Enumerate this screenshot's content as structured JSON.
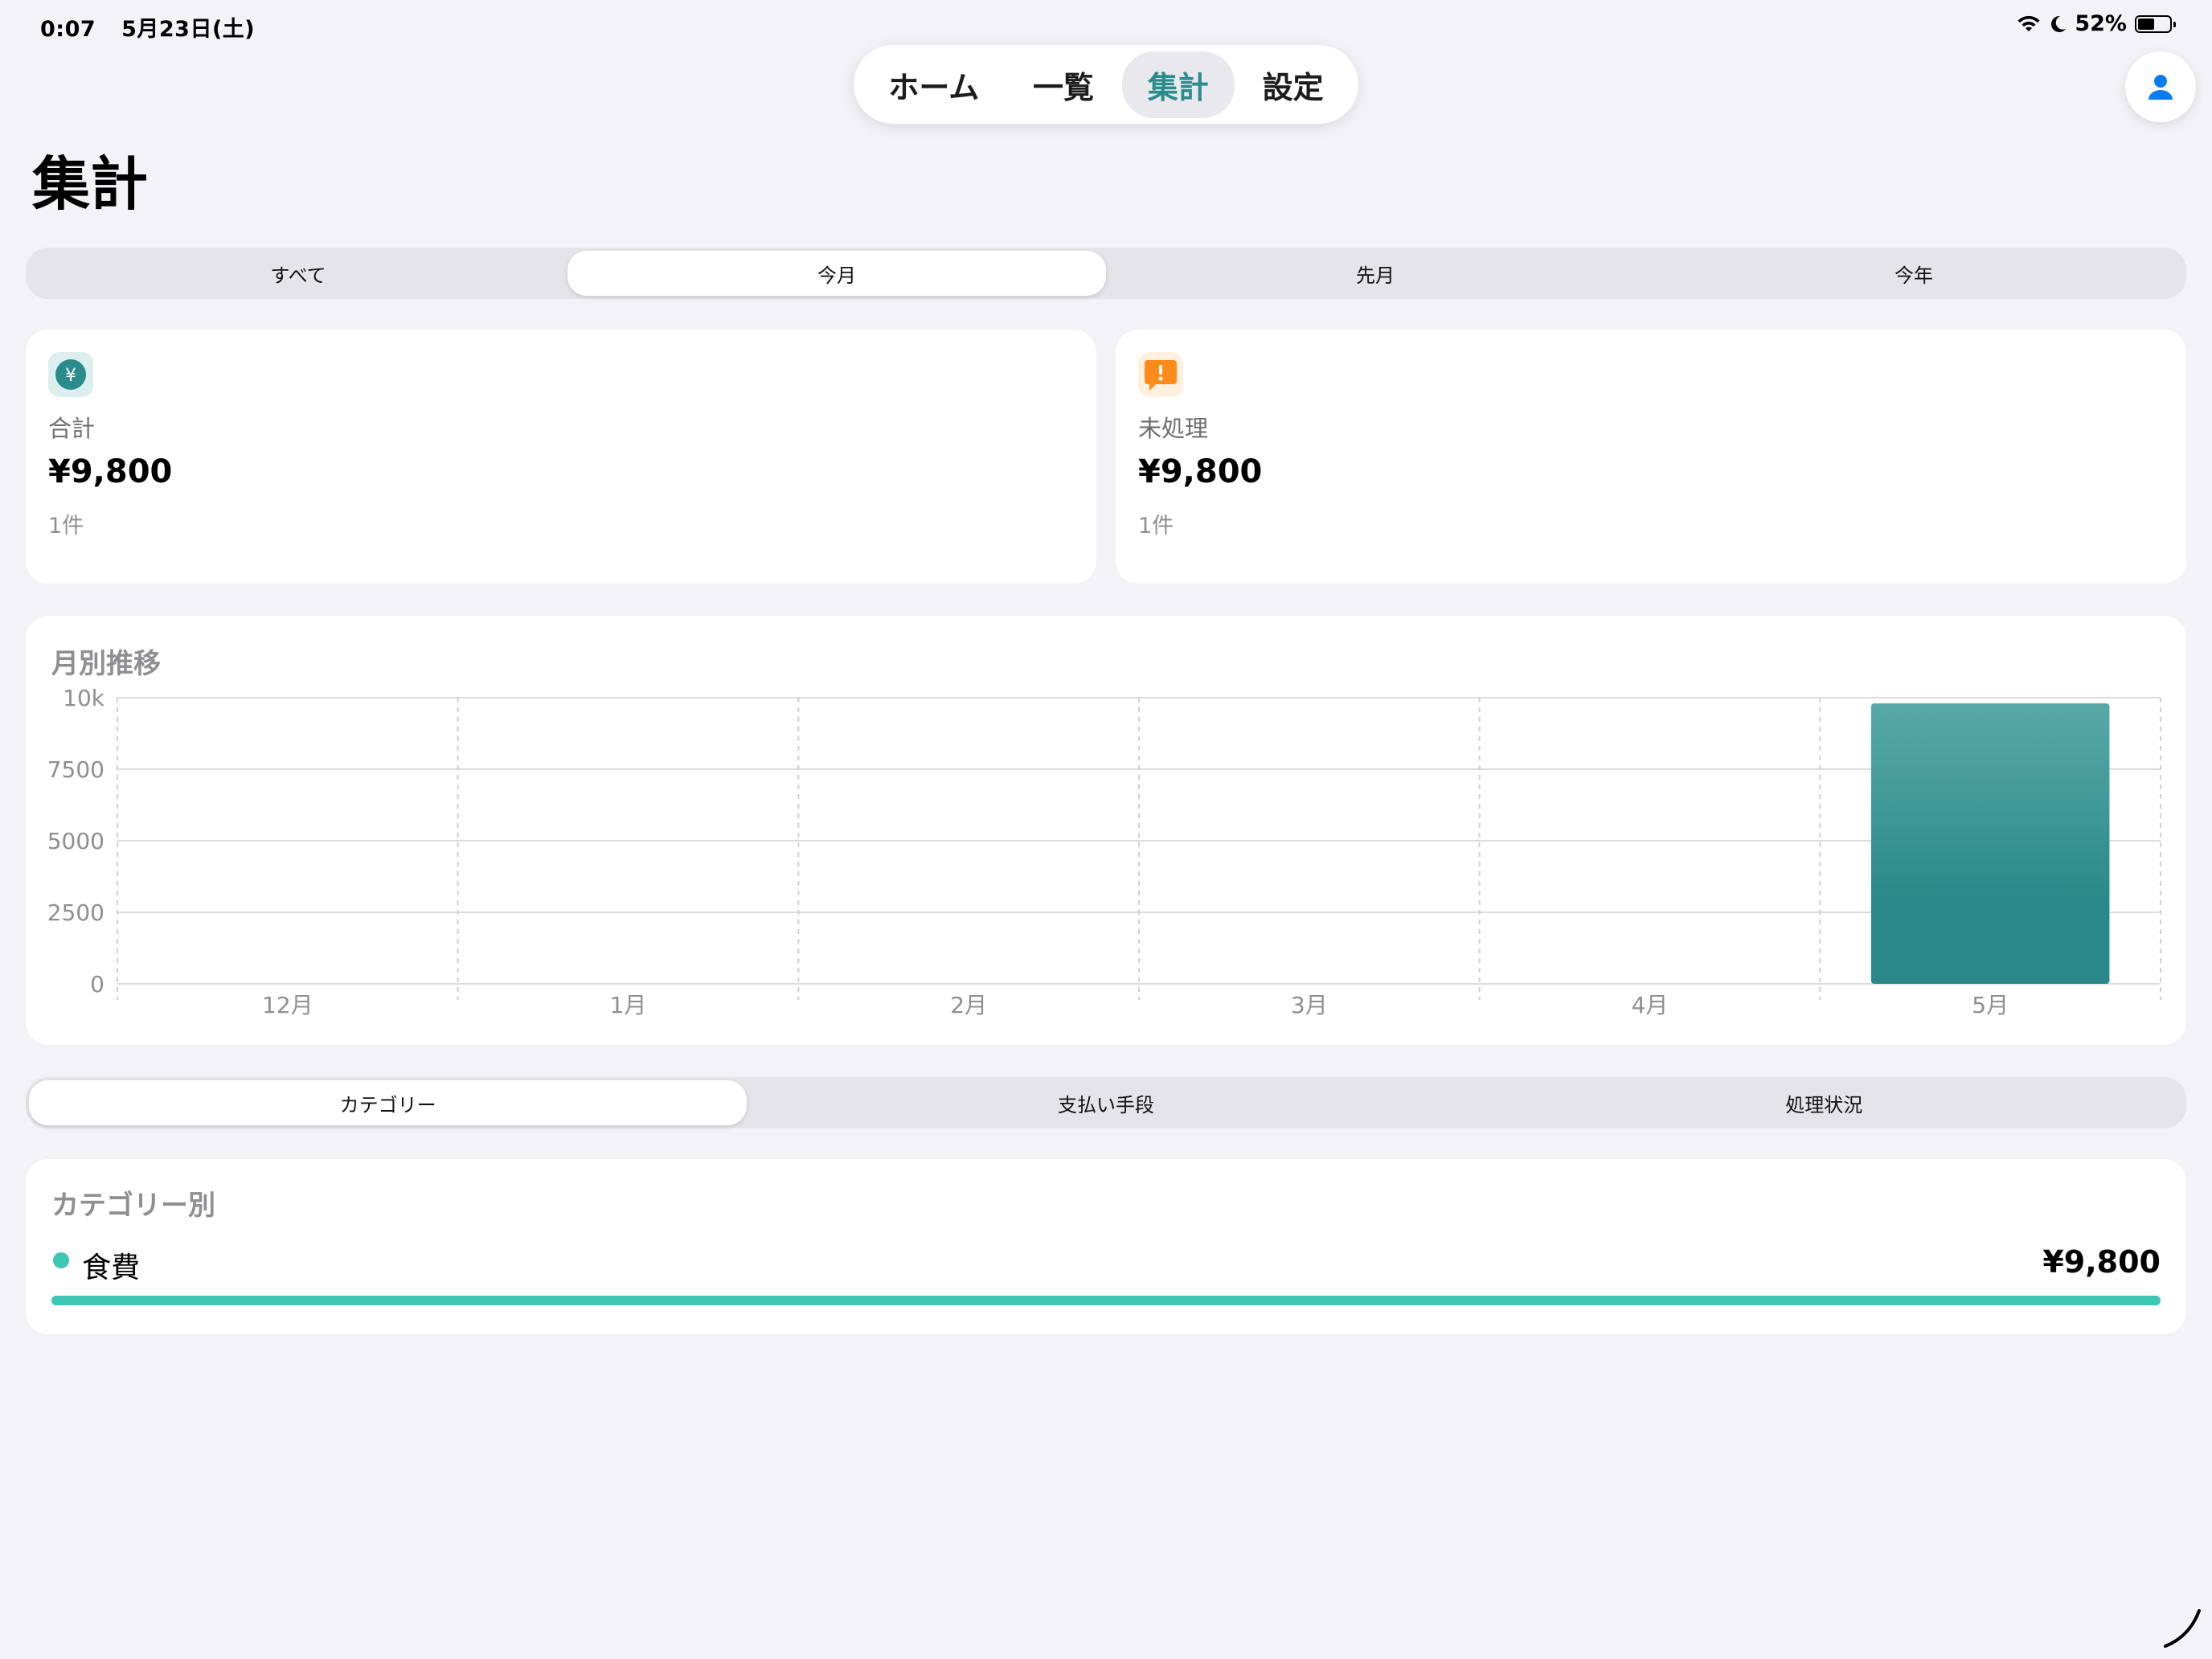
{
  "status_bar": {
    "time": "0:07",
    "date": "5月23日(土)",
    "battery": "52%",
    "battery_level": 0.52
  },
  "nav": {
    "items": [
      {
        "label": "ホーム",
        "active": false
      },
      {
        "label": "一覧",
        "active": false
      },
      {
        "label": "集計",
        "active": true
      },
      {
        "label": "設定",
        "active": false
      }
    ],
    "profile_icon": "person-icon"
  },
  "page_title": "集計",
  "period_filter": {
    "options": [
      "すべて",
      "今月",
      "先月",
      "今年"
    ],
    "selected": "今月"
  },
  "summary": {
    "total": {
      "icon": "yen-icon",
      "label": "合計",
      "amount": "¥9,800",
      "count": "1件",
      "icon_color": "#2a8c8c",
      "icon_bg": "#dcefee"
    },
    "pending": {
      "icon": "exclamation-bubble-icon",
      "label": "未処理",
      "amount": "¥9,800",
      "count": "1件",
      "icon_color": "#ff8c1a",
      "icon_bg": "#fff0e0"
    }
  },
  "monthly": {
    "title": "月別推移",
    "chart_data": {
      "type": "bar",
      "categories": [
        "12月",
        "1月",
        "2月",
        "3月",
        "4月",
        "5月"
      ],
      "values": [
        0,
        0,
        0,
        0,
        0,
        9800
      ],
      "ylim": [
        0,
        10000
      ],
      "yticks": [
        0,
        2500,
        5000,
        7500,
        10000
      ],
      "ytick_labels": [
        "0",
        "2500",
        "5000",
        "7500",
        "10k"
      ],
      "grid": true,
      "bar_color_top": "#57a9a8",
      "bar_color_bottom": "#2a8988"
    }
  },
  "breakdown_tabs": {
    "options": [
      "カテゴリー",
      "支払い手段",
      "処理状況"
    ],
    "selected": "カテゴリー"
  },
  "category_section": {
    "title": "カテゴリー別",
    "items": [
      {
        "name": "食費",
        "amount": "¥9,800",
        "share": 1.0,
        "color": "#3cc8b4"
      }
    ]
  }
}
